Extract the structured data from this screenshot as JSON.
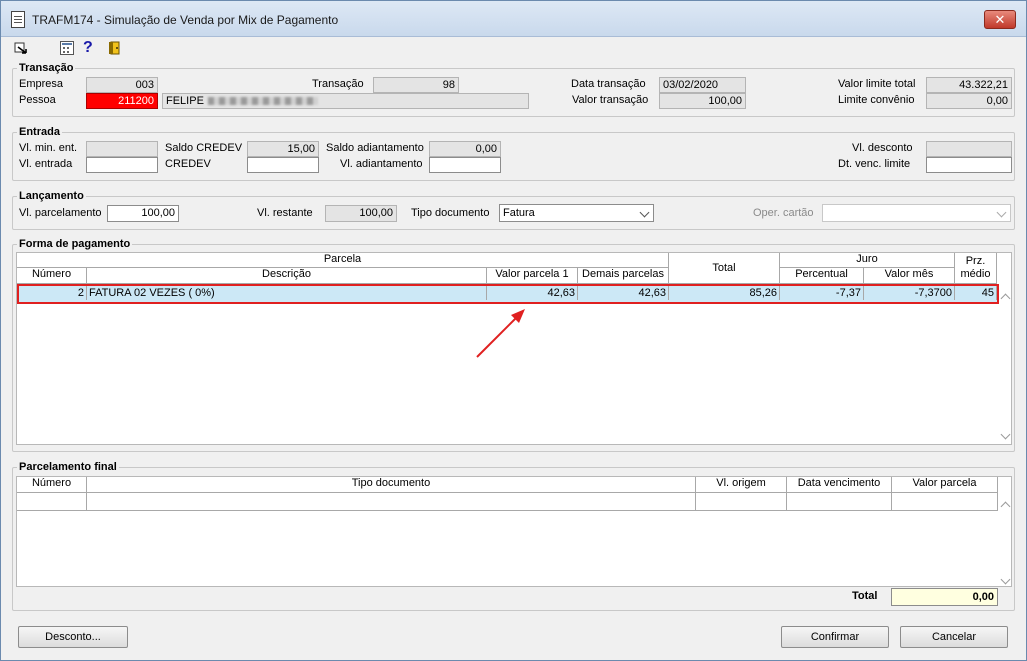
{
  "window": {
    "title": "TRAFM174 - Simulação de Venda por Mix de Pagamento",
    "close_label": "✕"
  },
  "toolbar": {
    "help_label": "?"
  },
  "transacao": {
    "legend": "Transação",
    "empresa_label": "Empresa",
    "empresa_value": "003",
    "pessoa_label": "Pessoa",
    "pessoa_code": "211200",
    "pessoa_name": "FELIPE",
    "transacao_label": "Transação",
    "transacao_value": "98",
    "data_label": "Data transação",
    "data_value": "03/02/2020",
    "valor_transacao_label": "Valor transação",
    "valor_transacao_value": "100,00",
    "valor_limite_label": "Valor limite total",
    "valor_limite_value": "43.322,21",
    "limite_convenio_label": "Limite convênio",
    "limite_convenio_value": "0,00"
  },
  "entrada": {
    "legend": "Entrada",
    "vl_min_label": "Vl. min. ent.",
    "vl_min_value": "",
    "vl_entrada_label": "Vl. entrada",
    "vl_entrada_value": "",
    "saldo_credev_label": "Saldo CREDEV",
    "saldo_credev_value": "15,00",
    "credev_label": "CREDEV",
    "credev_value": "",
    "saldo_adiant_label": "Saldo adiantamento",
    "saldo_adiant_value": "0,00",
    "vl_adiant_label": "Vl. adiantamento",
    "vl_adiant_value": "",
    "vl_desconto_label": "Vl. desconto",
    "vl_desconto_value": "",
    "dt_venc_label": "Dt. venc. limite",
    "dt_venc_value": ""
  },
  "lancamento": {
    "legend": "Lançamento",
    "vl_parcelamento_label": "Vl. parcelamento",
    "vl_parcelamento_value": "100,00",
    "vl_restante_label": "Vl. restante",
    "vl_restante_value": "100,00",
    "tipo_doc_label": "Tipo documento",
    "tipo_doc_value": "Fatura",
    "oper_cartao_label": "Oper. cartão",
    "oper_cartao_value": ""
  },
  "forma_pagamento": {
    "legend": "Forma de pagamento",
    "headers": {
      "parcela": "Parcela",
      "numero": "Número",
      "descricao": "Descrição",
      "valor_parcela": "Valor parcela 1",
      "demais": "Demais parcelas",
      "total": "Total",
      "juro": "Juro",
      "percentual": "Percentual",
      "valor_mes": "Valor mês",
      "prz": "Prz.",
      "medio": "médio"
    },
    "rows": [
      {
        "numero": "2",
        "descricao": "FATURA 02 VEZES ( 0%)",
        "valor_parcela": "42,63",
        "demais": "42,63",
        "total": "85,26",
        "percentual": "-7,37",
        "valor_mes": "-7,3700",
        "prz": "45"
      }
    ]
  },
  "parcelamento_final": {
    "legend": "Parcelamento final",
    "headers": {
      "numero": "Número",
      "tipo_doc": "Tipo documento",
      "vl_origem": "Vl. origem",
      "data_venc": "Data vencimento",
      "valor_parcela": "Valor parcela"
    },
    "total_label": "Total",
    "total_value": "0,00"
  },
  "buttons": {
    "desconto": "Desconto...",
    "confirmar": "Confirmar",
    "cancelar": "Cancelar"
  },
  "colors": {
    "pessoa_bg": "#ff0000",
    "selected_row": "#cce8f6",
    "highlight": "#e02020",
    "total_bg": "#ffffe0"
  }
}
